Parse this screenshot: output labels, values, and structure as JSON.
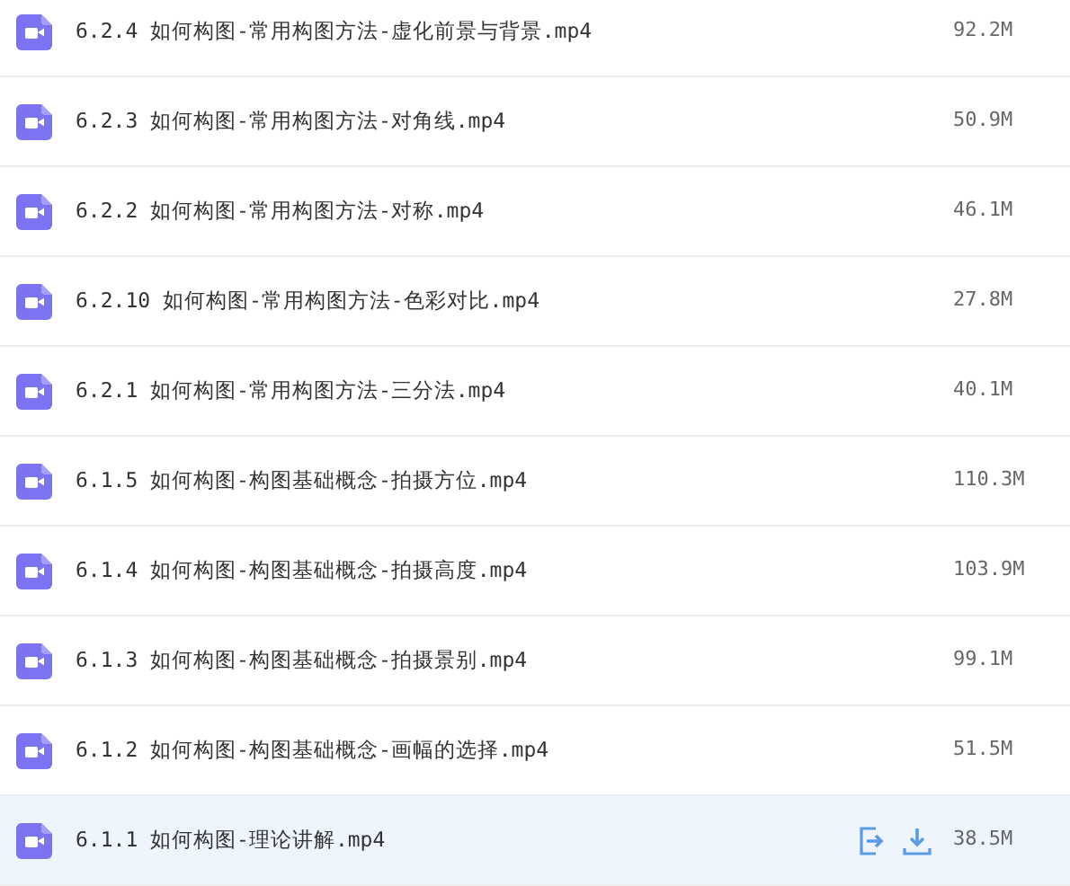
{
  "files": [
    {
      "name": "6.2.4 如何构图-常用构图方法-虚化前景与背景.mp4",
      "size": "92.2M",
      "selected": false
    },
    {
      "name": "6.2.3 如何构图-常用构图方法-对角线.mp4",
      "size": "50.9M",
      "selected": false
    },
    {
      "name": "6.2.2 如何构图-常用构图方法-对称.mp4",
      "size": "46.1M",
      "selected": false
    },
    {
      "name": "6.2.10 如何构图-常用构图方法-色彩对比.mp4",
      "size": "27.8M",
      "selected": false
    },
    {
      "name": "6.2.1 如何构图-常用构图方法-三分法.mp4",
      "size": "40.1M",
      "selected": false
    },
    {
      "name": "6.1.5 如何构图-构图基础概念-拍摄方位.mp4",
      "size": "110.3M",
      "selected": false
    },
    {
      "name": "6.1.4 如何构图-构图基础概念-拍摄高度.mp4",
      "size": "103.9M",
      "selected": false
    },
    {
      "name": "6.1.3 如何构图-构图基础概念-拍摄景别.mp4",
      "size": "99.1M",
      "selected": false
    },
    {
      "name": "6.1.2 如何构图-构图基础概念-画幅的选择.mp4",
      "size": "51.5M",
      "selected": false
    },
    {
      "name": "6.1.1 如何构图-理论讲解.mp4",
      "size": "38.5M",
      "selected": true
    }
  ]
}
